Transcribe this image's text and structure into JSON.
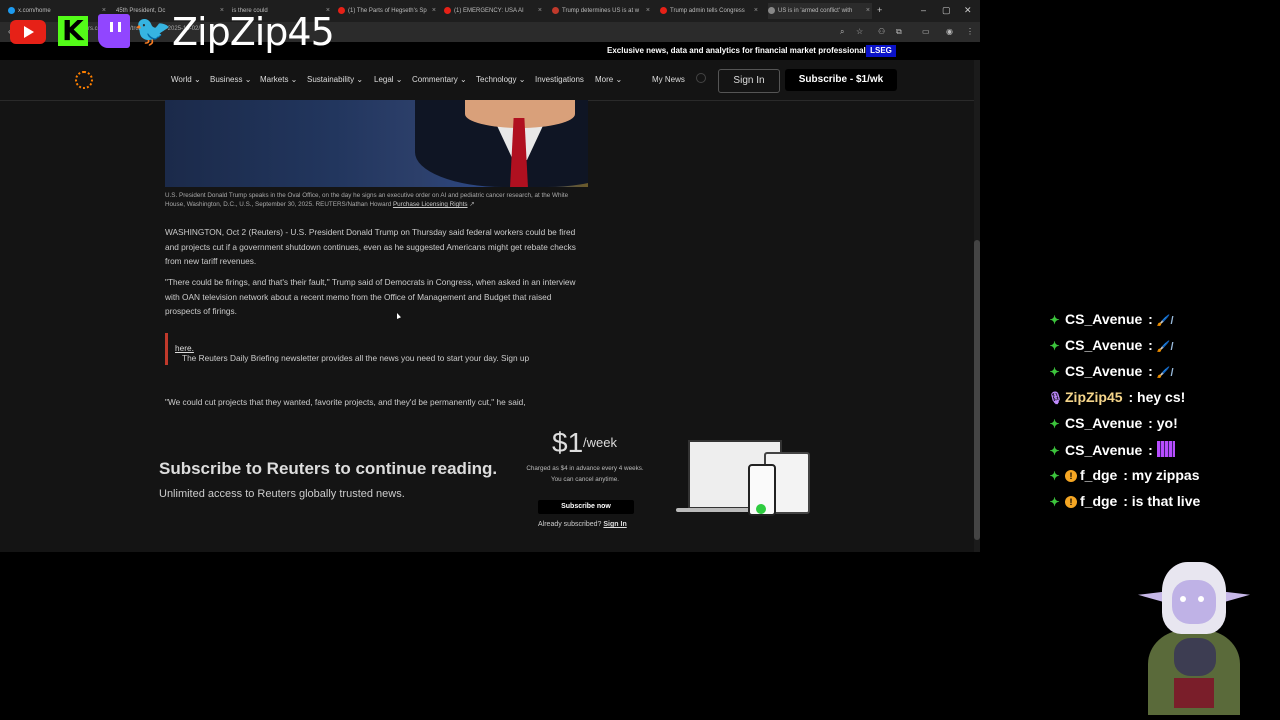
{
  "browser": {
    "tabs": [
      {
        "label": "x.com/home",
        "color": "#1d9bf0"
      },
      {
        "label": "45th President, Dc",
        "color": "#888"
      },
      {
        "label": "is there could",
        "color": "#888"
      },
      {
        "label": "(1) The Parts of Hegseth's Sp",
        "color": "#e62117"
      },
      {
        "label": "(1) EMERGENCY: USA AI",
        "color": "#e62117"
      },
      {
        "label": "Trump determines US is at w",
        "color": "#c0392b"
      },
      {
        "label": "Trump admin tells Congress",
        "color": "#e62117"
      },
      {
        "label": "US is in 'armed conflict' with",
        "color": "#888"
      }
    ],
    "new_tab": "+",
    "url": "rs.com/world/us/trump-...-ues-2025-10-02/",
    "win_min": "–",
    "win_max": "▢",
    "win_close": "✕"
  },
  "overlay": {
    "handle": "ZipZip45",
    "kick_letter": "K",
    "bird": "🐦"
  },
  "site": {
    "banner": "Exclusive news, data and analytics for financial market professionals",
    "lseg": "LSEG",
    "nav": [
      "World",
      "Business",
      "Markets",
      "Sustainability",
      "Legal",
      "Commentary",
      "Technology",
      "Investigations",
      "More"
    ],
    "my_news": "My News",
    "sign_in": "Sign In",
    "subscribe": "Subscribe - $1/wk"
  },
  "article": {
    "caption": "U.S. President Donald Trump speaks in the Oval Office, on the day he signs an executive order on AI and pediatric cancer research, at the White House, Washington, D.C., U.S., September 30, 2025. REUTERS/Nathan Howard",
    "caption_link": "Purchase Licensing Rights",
    "p1": "WASHINGTON, Oct 2 (Reuters) - U.S. President Donald Trump on Thursday said federal workers could be fired and projects cut if a government shutdown continues, even as he suggested Americans might get rebate checks from new tariff revenues.",
    "p2": "\"There could be firings, and that's their fault,\" Trump said of Democrats in Congress, when asked in an interview with OAN television network about a recent memo from the Office of Management and Budget that raised prospects of firings.",
    "callout": "The Reuters Daily Briefing newsletter provides all the news you need to start your day. Sign up",
    "callout_link": "here.",
    "p3": "\"We could cut projects that they wanted, favorite projects, and they'd be permanently cut,\" he said,"
  },
  "paywall": {
    "title": "Subscribe to Reuters to continue reading.",
    "subtitle": "Unlimited access to Reuters globally trusted news.",
    "price": "$1",
    "per": "/week",
    "charge_line1": "Charged as $4 in advance every 4 weeks.",
    "charge_line2": "You can cancel anytime.",
    "subscribe_now": "Subscribe now",
    "already": "Already subscribed?",
    "sign_in": "Sign In"
  },
  "chat": [
    {
      "badge": "✦",
      "badge_color": "#3cc43c",
      "user": "CS_Avenue",
      "user_color": "#ffffff",
      "message": "🖌️/"
    },
    {
      "badge": "✦",
      "badge_color": "#3cc43c",
      "user": "CS_Avenue",
      "user_color": "#ffffff",
      "message": "🖌️/"
    },
    {
      "badge": "✦",
      "badge_color": "#3cc43c",
      "user": "CS_Avenue",
      "user_color": "#ffffff",
      "message": "🖌️/"
    },
    {
      "badge": "🎙",
      "badge_color": "#c08cff",
      "user": "ZipZip45",
      "user_color": "#f5d58a",
      "message": "hey cs!"
    },
    {
      "badge": "✦",
      "badge_color": "#3cc43c",
      "user": "CS_Avenue",
      "user_color": "#ffffff",
      "message": "yo!"
    },
    {
      "badge": "✦",
      "badge_color": "#3cc43c",
      "user": "CS_Avenue",
      "user_color": "#ffffff",
      "message": ""
    },
    {
      "badge": "✦",
      "badge_color": "#3cc43c",
      "user": "f_dge",
      "user_color": "#ffffff",
      "message": "my zippas"
    },
    {
      "badge": "✦",
      "badge_color": "#3cc43c",
      "user": "f_dge",
      "user_color": "#ffffff",
      "message": "is that live"
    }
  ]
}
